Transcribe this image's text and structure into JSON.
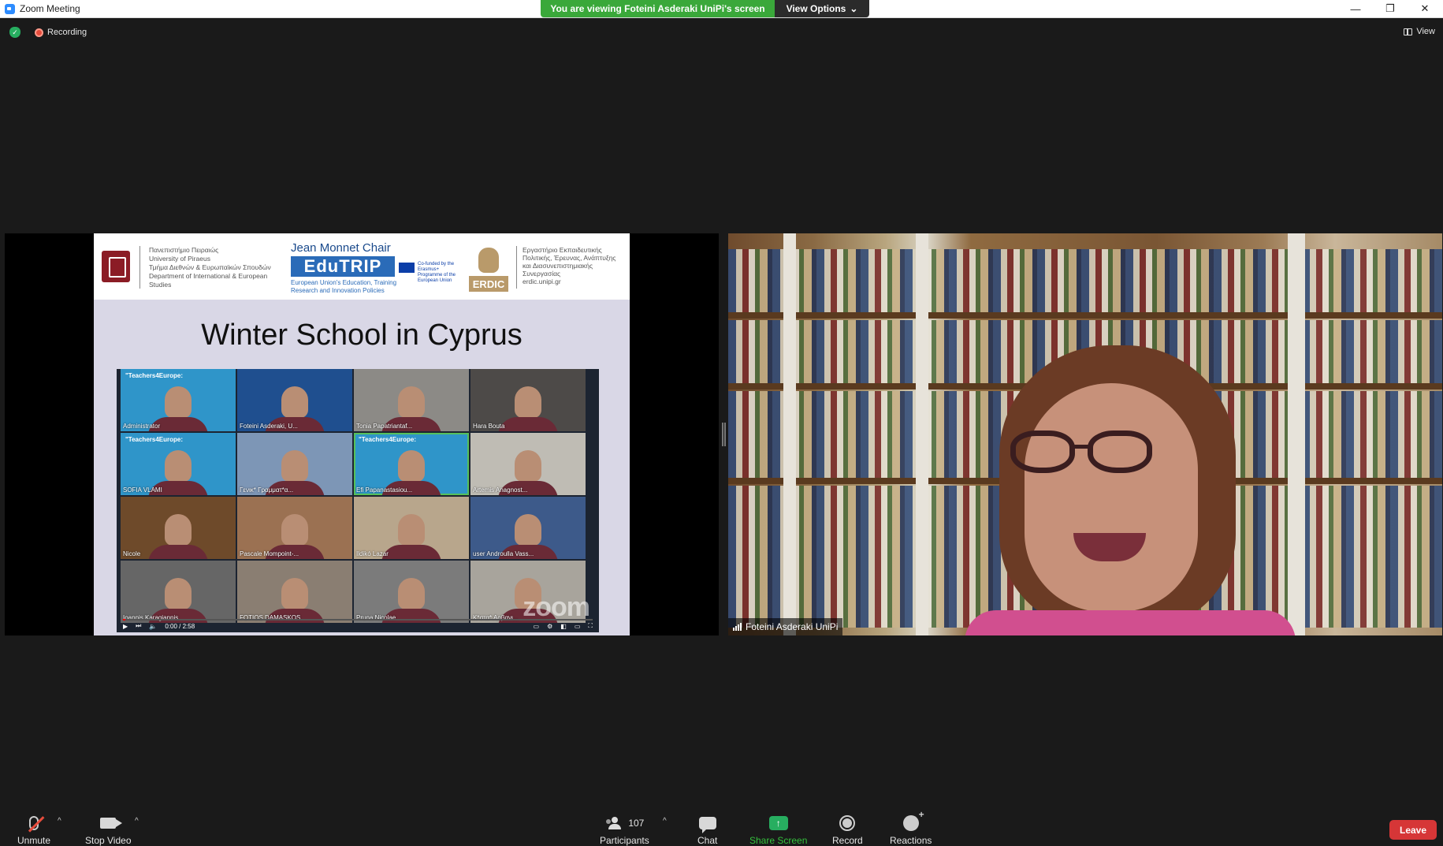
{
  "window": {
    "title": "Zoom Meeting",
    "controls": [
      "minimize",
      "restore",
      "close"
    ]
  },
  "banner": {
    "viewing_text": "You are viewing Foteini Asderaki UniPi's screen",
    "view_options_label": "View Options"
  },
  "top_bar": {
    "recording_label": "Recording",
    "view_label": "View"
  },
  "shared_slide": {
    "university_text": [
      "Πανεπιστήμιο Πειραιώς",
      "University of Piraeus",
      "Τμήμα Διεθνών & Ευρωπαϊκών Σπουδών",
      "Department of International & European",
      "Studies"
    ],
    "jean_monnet": "Jean Monnet Chair",
    "edutrip": "EduTRIP",
    "edutrip_sub": "European Union's Education, Training Research and Innovation Policies",
    "eu_text": "Co-funded by the Erasmus+ Programme of the European Union",
    "erdic_logo": "ERDIC",
    "erdic_text": [
      "Εργαστήριο Εκπαιδευτικής",
      "Πολιτικής, Έρευνας, Ανάπτυξης",
      "και Διασυνεπιστημιακής",
      "Συνεργασίας",
      "erdic.unipi.gr"
    ],
    "title": "Winter School in Cyprus",
    "poster_text": "\"Teachers4Europe:",
    "tiles": [
      {
        "name": "Administrator",
        "bg": "#2f95c9",
        "poster": true
      },
      {
        "name": "Foteini Asderaki, U...",
        "bg": "#1f4f8f",
        "poster": false
      },
      {
        "name": "Tonia Papatriantaf...",
        "bg": "#8c8a86",
        "poster": false
      },
      {
        "name": "Hara Bouta",
        "bg": "#4d4a48",
        "poster": false
      },
      {
        "name": "SOFIA VLAMI",
        "bg": "#2f95c9",
        "poster": true
      },
      {
        "name": "Γενικ* Γραμματ*α...",
        "bg": "#7d96b6",
        "poster": false
      },
      {
        "name": "Efi Papanastasiou...",
        "bg": "#2f95c9",
        "poster": true,
        "active": true
      },
      {
        "name": "Artemis Anagnost...",
        "bg": "#bfbcb4",
        "poster": false
      },
      {
        "name": "Nicole",
        "bg": "#6e4a2a",
        "poster": false
      },
      {
        "name": "Pascale Mompoint-...",
        "bg": "#9b7152",
        "poster": false
      },
      {
        "name": "Ildikó Lazar",
        "bg": "#b8a68c",
        "poster": false
      },
      {
        "name": "user Androulla Vass...",
        "bg": "#3d5a8a",
        "poster": false
      },
      {
        "name": "Ioannis Karagiannis",
        "bg": "#666666",
        "poster": false
      },
      {
        "name": "FOTIOS DAMASKOS",
        "bg": "#8a7e72",
        "poster": false
      },
      {
        "name": "Pruna Nicolae",
        "bg": "#7b7b7b",
        "poster": false
      },
      {
        "name": "K*στα* Αρβανι...",
        "bg": "#a8a49c",
        "poster": false
      }
    ],
    "video_time": "0:00 / 2:58",
    "watermark": "zoom"
  },
  "speaker": {
    "name": "Foteini Asderaki UniPi"
  },
  "toolbar": {
    "unmute": "Unmute",
    "stop_video": "Stop Video",
    "participants": "Participants",
    "participants_count": "107",
    "chat": "Chat",
    "share_screen": "Share Screen",
    "record": "Record",
    "reactions": "Reactions",
    "leave": "Leave"
  }
}
